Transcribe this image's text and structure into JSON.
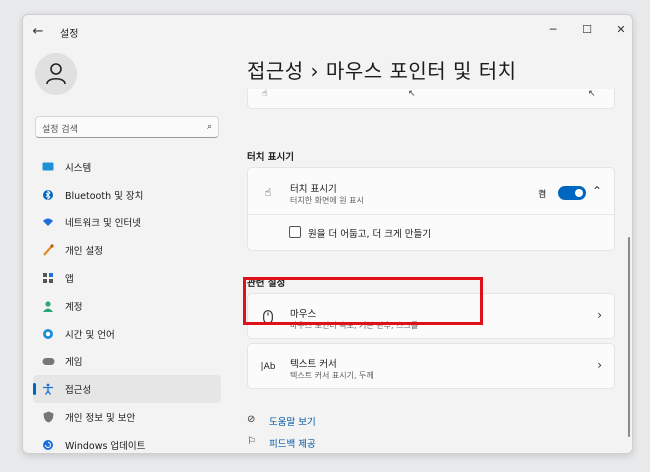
{
  "window": {
    "title": "설정"
  },
  "sidebar": {
    "search_placeholder": "설정 검색",
    "items": [
      {
        "label": "시스템",
        "icon": "display-icon",
        "color": "#1e90d6"
      },
      {
        "label": "Bluetooth 및 장치",
        "icon": "bluetooth-icon",
        "color": "#0067c0"
      },
      {
        "label": "네트워크 및 인터넷",
        "icon": "wifi-icon",
        "color": "#1e6fd9"
      },
      {
        "label": "개인 설정",
        "icon": "brush-icon",
        "color": "#e08a2a"
      },
      {
        "label": "앱",
        "icon": "apps-icon",
        "color": "#555555"
      },
      {
        "label": "계정",
        "icon": "person-icon",
        "color": "#2aa876"
      },
      {
        "label": "시간 및 언어",
        "icon": "globe-clock-icon",
        "color": "#1e8fd6"
      },
      {
        "label": "게임",
        "icon": "gamepad-icon",
        "color": "#777777"
      },
      {
        "label": "접근성",
        "icon": "accessibility-icon",
        "color": "#1e6fd9"
      },
      {
        "label": "개인 정보 및 보안",
        "icon": "shield-icon",
        "color": "#777777"
      },
      {
        "label": "Windows 업데이트",
        "icon": "update-icon",
        "color": "#1e6fd9"
      }
    ],
    "active_index": 8
  },
  "header": {
    "title": "접근성  ›  마우스 포인터 및 터치"
  },
  "touch_section": {
    "label": "터치 표시기",
    "title": "터치 표시기",
    "subtitle": "터치한 화면에 원 표시",
    "toggle_state": "켬",
    "toggle_on": true,
    "checkbox_label": "원을 더 어둡고, 더 크게 만들기",
    "checkbox_checked": false
  },
  "related_section": {
    "label": "관련 설정",
    "items": [
      {
        "title": "마우스",
        "subtitle": "마우스 포인터 속도, 기본 단추, 스크롤",
        "icon": "mouse-icon"
      },
      {
        "title": "텍스트 커서",
        "subtitle": "텍스트 커서 표시기, 두께",
        "icon": "text-cursor-icon"
      }
    ]
  },
  "links": [
    {
      "label": "도움말 보기",
      "icon": "help-icon"
    },
    {
      "label": "피드백 제공",
      "icon": "feedback-icon"
    }
  ],
  "accent_color": "#0067c0",
  "highlight_color": "#e0101a"
}
